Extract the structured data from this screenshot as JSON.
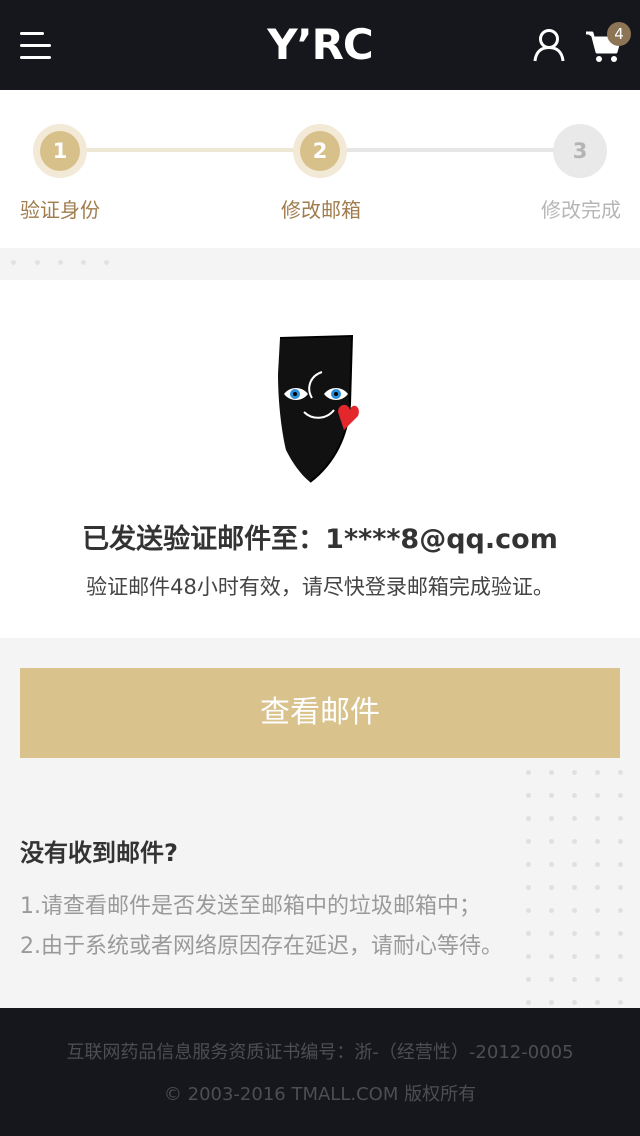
{
  "header": {
    "logo": "Y’RC",
    "cart_count": "4",
    "icons": {
      "menu": "menu-icon",
      "user": "user-icon",
      "cart": "cart-icon"
    }
  },
  "steps": [
    {
      "number": "1",
      "label": "验证身份",
      "state": "done"
    },
    {
      "number": "2",
      "label": "修改邮箱",
      "state": "active"
    },
    {
      "number": "3",
      "label": "修改完成",
      "state": "pending"
    }
  ],
  "message": {
    "title": "已发送验证邮件至：1****8@qq.com",
    "note": "验证邮件48小时有效，请尽快登录邮箱完成验证。"
  },
  "action": {
    "view_mail_label": "查看邮件"
  },
  "help": {
    "title": "没有收到邮件?",
    "items": [
      "1.请查看邮件是否发送至邮箱中的垃圾邮箱中；",
      "2.由于系统或者网络原因存在延迟，请耐心等待。"
    ]
  },
  "footer": {
    "license": "互联网药品信息服务资质证书编号：浙-（经营性）-2012-0005",
    "copyright": "© 2003-2016 TMALL.COM 版权所有"
  },
  "colors": {
    "header_bg": "#15171c",
    "accent_gold": "#d9c28c",
    "step_label_active": "#a07c4e",
    "badge": "#8c7554"
  }
}
